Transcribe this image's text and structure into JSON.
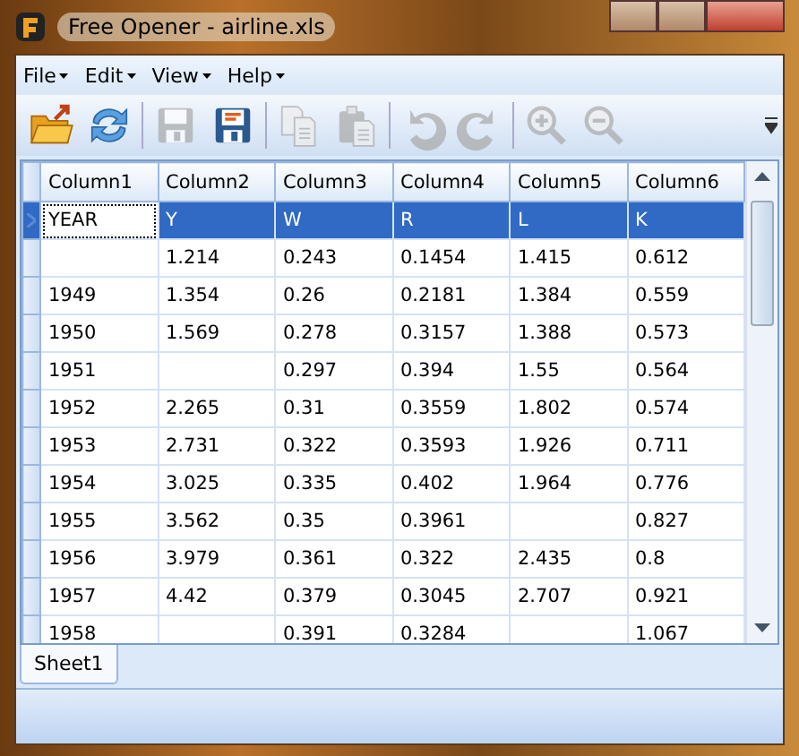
{
  "window": {
    "title": "Free Opener - airline.xls"
  },
  "menu": [
    "File",
    "Edit",
    "View",
    "Help"
  ],
  "toolbar": [
    {
      "kind": "open",
      "disabled": false
    },
    {
      "kind": "refresh",
      "disabled": false
    },
    {
      "kind": "save",
      "disabled": true
    },
    {
      "kind": "saveas",
      "disabled": false
    },
    {
      "kind": "copy",
      "disabled": true
    },
    {
      "kind": "paste",
      "disabled": true
    },
    {
      "kind": "undo",
      "disabled": true
    },
    {
      "kind": "redo",
      "disabled": true
    },
    {
      "kind": "zoomin",
      "disabled": true
    },
    {
      "kind": "zoomout",
      "disabled": true
    }
  ],
  "table": {
    "columns": [
      "Column1",
      "Column2",
      "Column3",
      "Column4",
      "Column5",
      "Column6"
    ],
    "rows": [
      {
        "selected": true,
        "cells": [
          "YEAR",
          "Y",
          "W",
          "R",
          "L",
          "K"
        ]
      },
      {
        "selected": false,
        "cells": [
          "",
          "1.214",
          "0.243",
          "0.1454",
          "1.415",
          "0.612"
        ]
      },
      {
        "selected": false,
        "cells": [
          "1949",
          "1.354",
          "0.26",
          "0.2181",
          "1.384",
          "0.559"
        ]
      },
      {
        "selected": false,
        "cells": [
          "1950",
          "1.569",
          "0.278",
          "0.3157",
          "1.388",
          "0.573"
        ]
      },
      {
        "selected": false,
        "cells": [
          "1951",
          "",
          "0.297",
          "0.394",
          "1.55",
          "0.564"
        ]
      },
      {
        "selected": false,
        "cells": [
          "1952",
          "2.265",
          "0.31",
          "0.3559",
          "1.802",
          "0.574"
        ]
      },
      {
        "selected": false,
        "cells": [
          "1953",
          "2.731",
          "0.322",
          "0.3593",
          "1.926",
          "0.711"
        ]
      },
      {
        "selected": false,
        "cells": [
          "1954",
          "3.025",
          "0.335",
          "0.402",
          "1.964",
          "0.776"
        ]
      },
      {
        "selected": false,
        "cells": [
          "1955",
          "3.562",
          "0.35",
          "0.3961",
          "",
          "0.827"
        ]
      },
      {
        "selected": false,
        "cells": [
          "1956",
          "3.979",
          "0.361",
          "0.322",
          "2.435",
          "0.8"
        ]
      },
      {
        "selected": false,
        "cells": [
          "1957",
          "4.42",
          "0.379",
          "0.3045",
          "2.707",
          "0.921"
        ]
      },
      {
        "selected": false,
        "cells": [
          "1958",
          "",
          "0.391",
          "0.3284",
          "",
          "1.067"
        ]
      }
    ]
  },
  "sheet_tabs": [
    {
      "label": "Sheet1",
      "selected": true
    }
  ]
}
